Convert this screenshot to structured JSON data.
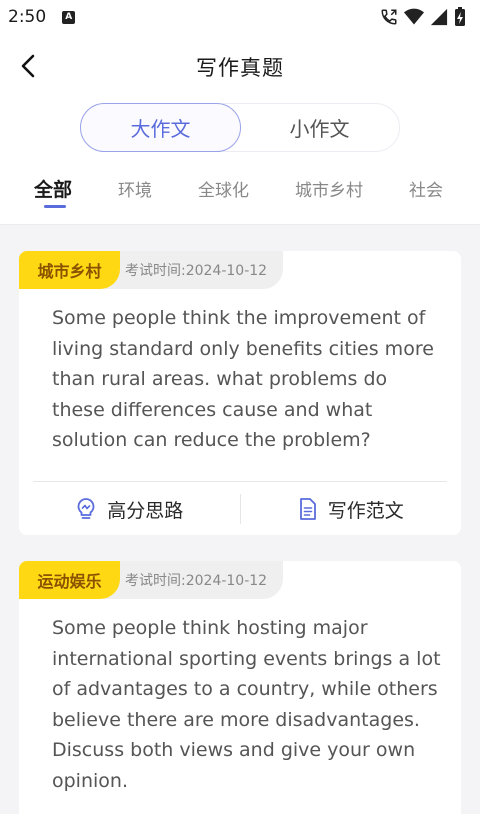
{
  "status": {
    "time": "2:50",
    "badge": "A"
  },
  "header": {
    "title": "写作真题"
  },
  "segments": [
    "大作文",
    "小作文"
  ],
  "tabs": [
    "全部",
    "环境",
    "全球化",
    "城市乡村",
    "社会"
  ],
  "cards": [
    {
      "category": "城市乡村",
      "date": "考试时间:2024-10-12",
      "text": "Some people think the improvement of living standard only benefits cities more than rural areas. what problems do these differences cause and what solution can reduce the problem?",
      "action_ideas": "高分思路",
      "action_sample": "写作范文"
    },
    {
      "category": "运动娱乐",
      "date": "考试时间:2024-10-12",
      "text": "Some people think hosting major international sporting events brings a lot of advantages to a country, while others believe there are more disadvantages. Discuss both views and give your own opinion."
    }
  ],
  "colors": {
    "accent": "#5a6bdc",
    "tag": "#ffd814"
  }
}
